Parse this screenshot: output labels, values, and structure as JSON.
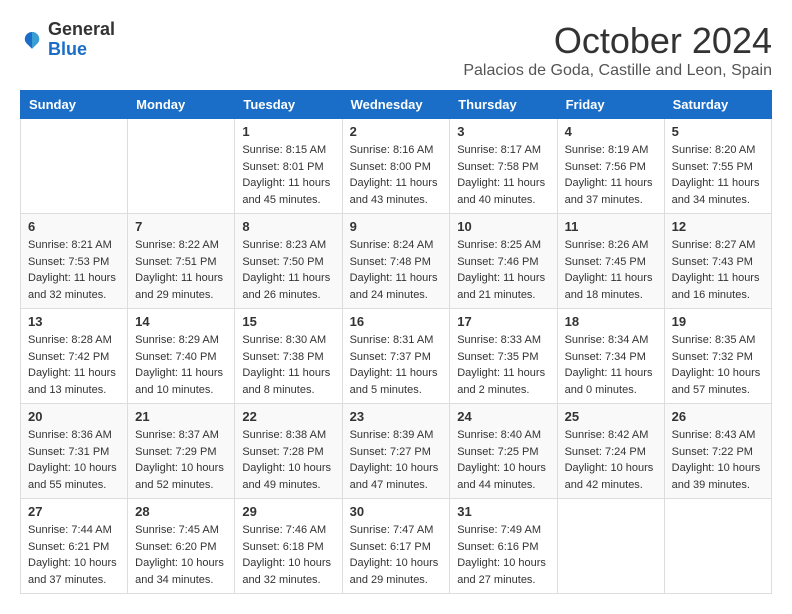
{
  "header": {
    "logo_general": "General",
    "logo_blue": "Blue",
    "month": "October 2024",
    "location": "Palacios de Goda, Castille and Leon, Spain"
  },
  "weekdays": [
    "Sunday",
    "Monday",
    "Tuesday",
    "Wednesday",
    "Thursday",
    "Friday",
    "Saturday"
  ],
  "weeks": [
    [
      null,
      null,
      {
        "day": 1,
        "sunrise": "8:15 AM",
        "sunset": "8:01 PM",
        "daylight": "11 hours and 45 minutes."
      },
      {
        "day": 2,
        "sunrise": "8:16 AM",
        "sunset": "8:00 PM",
        "daylight": "11 hours and 43 minutes."
      },
      {
        "day": 3,
        "sunrise": "8:17 AM",
        "sunset": "7:58 PM",
        "daylight": "11 hours and 40 minutes."
      },
      {
        "day": 4,
        "sunrise": "8:19 AM",
        "sunset": "7:56 PM",
        "daylight": "11 hours and 37 minutes."
      },
      {
        "day": 5,
        "sunrise": "8:20 AM",
        "sunset": "7:55 PM",
        "daylight": "11 hours and 34 minutes."
      }
    ],
    [
      {
        "day": 6,
        "sunrise": "8:21 AM",
        "sunset": "7:53 PM",
        "daylight": "11 hours and 32 minutes."
      },
      {
        "day": 7,
        "sunrise": "8:22 AM",
        "sunset": "7:51 PM",
        "daylight": "11 hours and 29 minutes."
      },
      {
        "day": 8,
        "sunrise": "8:23 AM",
        "sunset": "7:50 PM",
        "daylight": "11 hours and 26 minutes."
      },
      {
        "day": 9,
        "sunrise": "8:24 AM",
        "sunset": "7:48 PM",
        "daylight": "11 hours and 24 minutes."
      },
      {
        "day": 10,
        "sunrise": "8:25 AM",
        "sunset": "7:46 PM",
        "daylight": "11 hours and 21 minutes."
      },
      {
        "day": 11,
        "sunrise": "8:26 AM",
        "sunset": "7:45 PM",
        "daylight": "11 hours and 18 minutes."
      },
      {
        "day": 12,
        "sunrise": "8:27 AM",
        "sunset": "7:43 PM",
        "daylight": "11 hours and 16 minutes."
      }
    ],
    [
      {
        "day": 13,
        "sunrise": "8:28 AM",
        "sunset": "7:42 PM",
        "daylight": "11 hours and 13 minutes."
      },
      {
        "day": 14,
        "sunrise": "8:29 AM",
        "sunset": "7:40 PM",
        "daylight": "11 hours and 10 minutes."
      },
      {
        "day": 15,
        "sunrise": "8:30 AM",
        "sunset": "7:38 PM",
        "daylight": "11 hours and 8 minutes."
      },
      {
        "day": 16,
        "sunrise": "8:31 AM",
        "sunset": "7:37 PM",
        "daylight": "11 hours and 5 minutes."
      },
      {
        "day": 17,
        "sunrise": "8:33 AM",
        "sunset": "7:35 PM",
        "daylight": "11 hours and 2 minutes."
      },
      {
        "day": 18,
        "sunrise": "8:34 AM",
        "sunset": "7:34 PM",
        "daylight": "11 hours and 0 minutes."
      },
      {
        "day": 19,
        "sunrise": "8:35 AM",
        "sunset": "7:32 PM",
        "daylight": "10 hours and 57 minutes."
      }
    ],
    [
      {
        "day": 20,
        "sunrise": "8:36 AM",
        "sunset": "7:31 PM",
        "daylight": "10 hours and 55 minutes."
      },
      {
        "day": 21,
        "sunrise": "8:37 AM",
        "sunset": "7:29 PM",
        "daylight": "10 hours and 52 minutes."
      },
      {
        "day": 22,
        "sunrise": "8:38 AM",
        "sunset": "7:28 PM",
        "daylight": "10 hours and 49 minutes."
      },
      {
        "day": 23,
        "sunrise": "8:39 AM",
        "sunset": "7:27 PM",
        "daylight": "10 hours and 47 minutes."
      },
      {
        "day": 24,
        "sunrise": "8:40 AM",
        "sunset": "7:25 PM",
        "daylight": "10 hours and 44 minutes."
      },
      {
        "day": 25,
        "sunrise": "8:42 AM",
        "sunset": "7:24 PM",
        "daylight": "10 hours and 42 minutes."
      },
      {
        "day": 26,
        "sunrise": "8:43 AM",
        "sunset": "7:22 PM",
        "daylight": "10 hours and 39 minutes."
      }
    ],
    [
      {
        "day": 27,
        "sunrise": "7:44 AM",
        "sunset": "6:21 PM",
        "daylight": "10 hours and 37 minutes."
      },
      {
        "day": 28,
        "sunrise": "7:45 AM",
        "sunset": "6:20 PM",
        "daylight": "10 hours and 34 minutes."
      },
      {
        "day": 29,
        "sunrise": "7:46 AM",
        "sunset": "6:18 PM",
        "daylight": "10 hours and 32 minutes."
      },
      {
        "day": 30,
        "sunrise": "7:47 AM",
        "sunset": "6:17 PM",
        "daylight": "10 hours and 29 minutes."
      },
      {
        "day": 31,
        "sunrise": "7:49 AM",
        "sunset": "6:16 PM",
        "daylight": "10 hours and 27 minutes."
      },
      null,
      null
    ]
  ],
  "labels": {
    "sunrise_label": "Sunrise: ",
    "sunset_label": "Sunset: ",
    "daylight_label": "Daylight: "
  }
}
